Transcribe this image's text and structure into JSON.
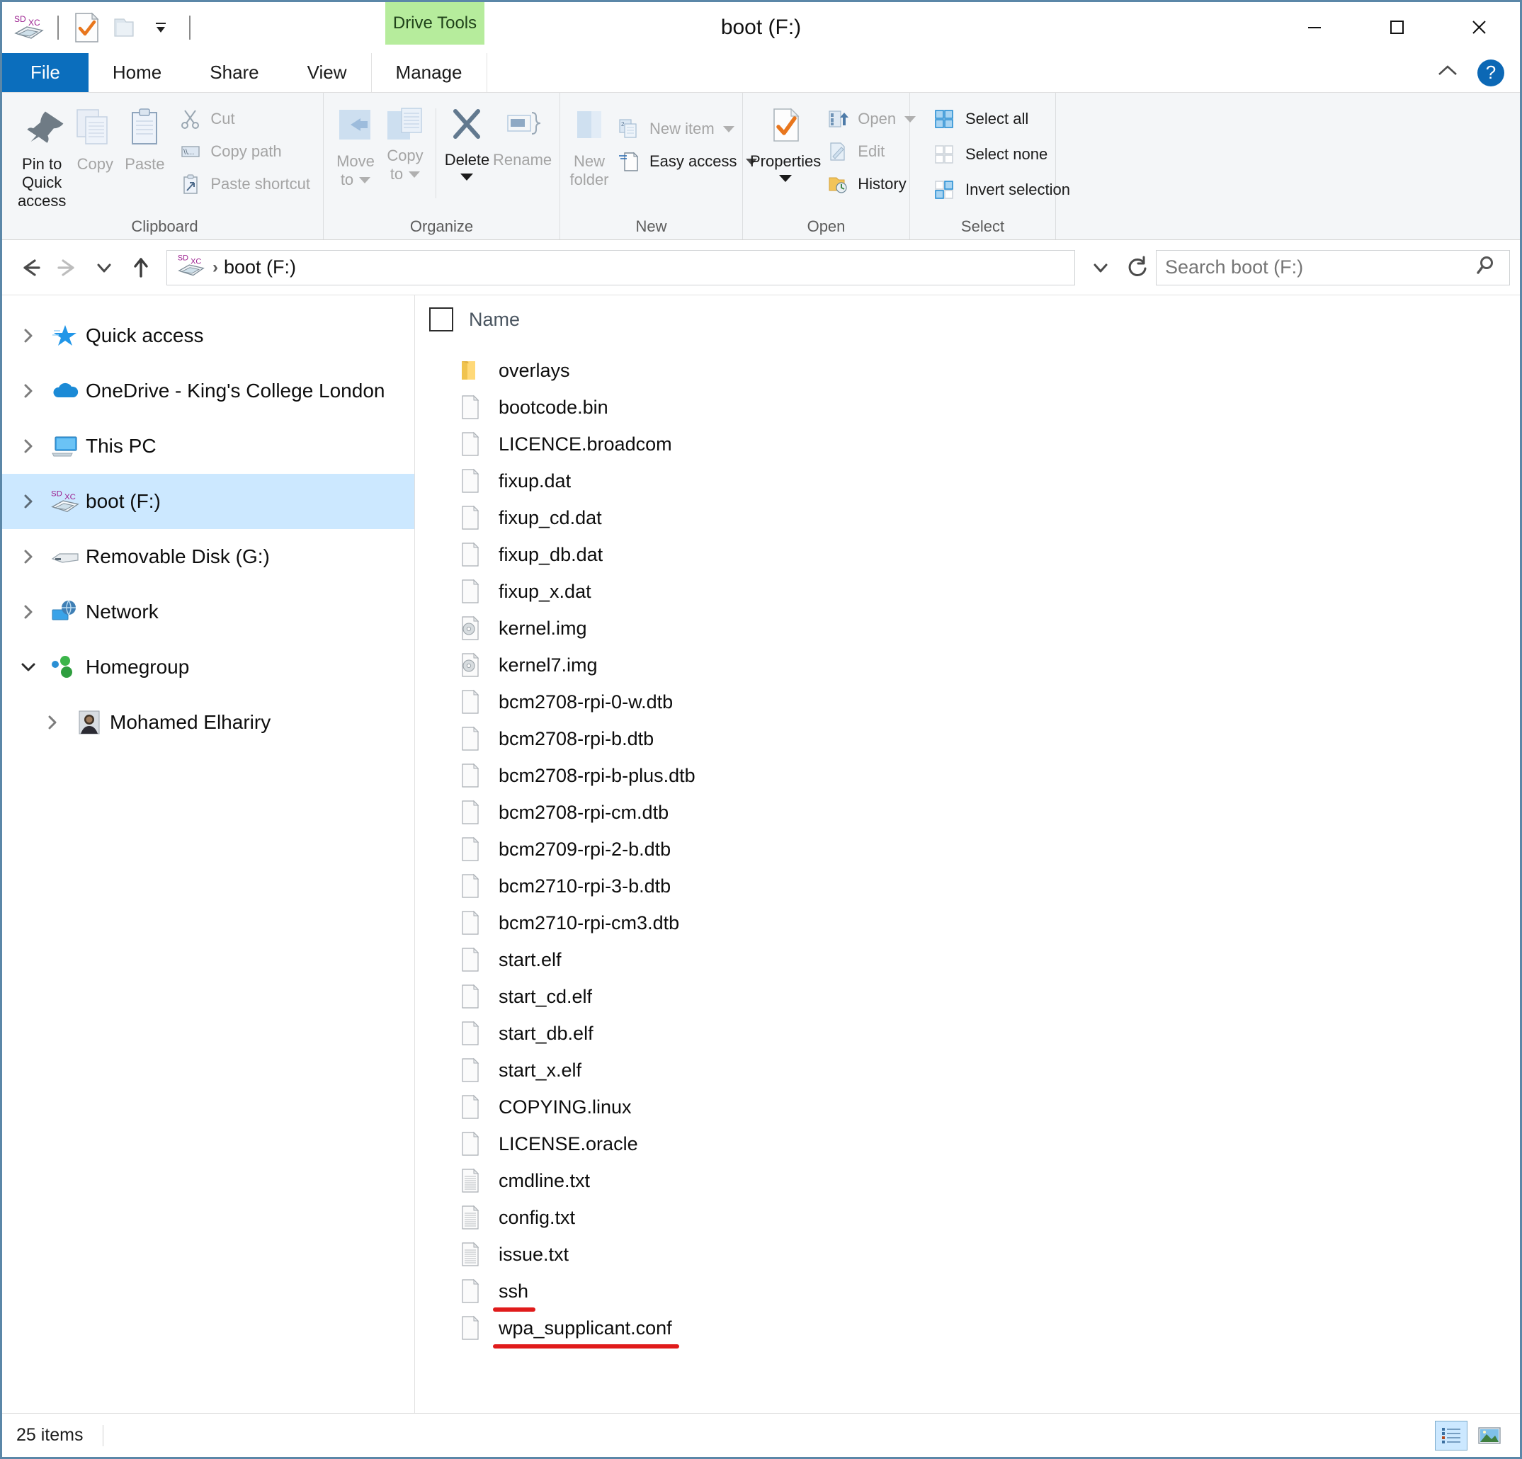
{
  "window": {
    "title": "boot (F:)",
    "contextual_tab": "Drive Tools",
    "minimize_label": "Minimize",
    "maximize_label": "Maximize",
    "close_label": "Close"
  },
  "quick_access_toolbar": {
    "items": [
      {
        "name": "drive-icon",
        "label": "boot (F:)"
      },
      {
        "name": "properties-icon",
        "label": "Properties"
      },
      {
        "name": "new-folder-icon",
        "label": "New folder"
      },
      {
        "name": "customize-icon",
        "label": "Customize Quick Access Toolbar"
      }
    ]
  },
  "tabs": [
    {
      "label": "File",
      "active": false,
      "kind": "file"
    },
    {
      "label": "Home",
      "active": true,
      "kind": "normal"
    },
    {
      "label": "Share",
      "active": false,
      "kind": "normal"
    },
    {
      "label": "View",
      "active": false,
      "kind": "normal"
    },
    {
      "label": "Manage",
      "active": false,
      "kind": "contextual"
    }
  ],
  "tab_right": {
    "collapse_ribbon_label": "Minimize the Ribbon",
    "help_label": "?"
  },
  "ribbon": {
    "groups": [
      {
        "title": "Clipboard",
        "big_buttons": [
          {
            "label": "Pin to Quick access",
            "label_line1": "Pin to Quick",
            "label_line2": "access",
            "icon": "pin-icon",
            "disabled": false
          },
          {
            "label": "Copy",
            "icon": "copy-icon",
            "disabled": true
          },
          {
            "label": "Paste",
            "icon": "paste-icon",
            "disabled": true
          }
        ],
        "small_buttons": [
          {
            "label": "Cut",
            "icon": "scissors-icon",
            "disabled": true,
            "dropdown": false
          },
          {
            "label": "Copy path",
            "icon": "copy-path-icon",
            "disabled": true,
            "dropdown": false
          },
          {
            "label": "Paste shortcut",
            "icon": "paste-shortcut-icon",
            "disabled": true,
            "dropdown": false
          }
        ]
      },
      {
        "title": "Organize",
        "big_buttons": [
          {
            "label": "Move to",
            "label_line1": "Move",
            "label_line2": "to",
            "icon": "move-to-icon",
            "disabled": true,
            "dropdown": true
          },
          {
            "label": "Copy to",
            "label_line1": "Copy",
            "label_line2": "to",
            "icon": "copy-to-icon",
            "disabled": true,
            "dropdown": true
          },
          {
            "label": "Delete",
            "icon": "delete-icon",
            "disabled": false,
            "dropdown": true
          },
          {
            "label": "Rename",
            "icon": "rename-icon",
            "disabled": true,
            "dropdown": false
          }
        ],
        "small_buttons": []
      },
      {
        "title": "New",
        "big_buttons": [
          {
            "label": "New folder",
            "label_line1": "New",
            "label_line2": "folder",
            "icon": "new-folder-icon",
            "disabled": true
          }
        ],
        "small_buttons": [
          {
            "label": "New item",
            "icon": "new-item-icon",
            "disabled": true,
            "dropdown": true
          },
          {
            "label": "Easy access",
            "icon": "easy-access-icon",
            "disabled": false,
            "dropdown": true
          }
        ]
      },
      {
        "title": "Open",
        "big_buttons": [
          {
            "label": "Properties",
            "icon": "properties-icon",
            "disabled": false,
            "dropdown": true
          }
        ],
        "small_buttons": [
          {
            "label": "Open",
            "icon": "open-icon",
            "disabled": true,
            "dropdown": true
          },
          {
            "label": "Edit",
            "icon": "edit-icon",
            "disabled": true,
            "dropdown": false
          },
          {
            "label": "History",
            "icon": "history-icon",
            "disabled": false,
            "dropdown": false
          }
        ]
      },
      {
        "title": "Select",
        "big_buttons": [],
        "small_buttons": [
          {
            "label": "Select all",
            "icon": "select-all-icon",
            "disabled": false,
            "dropdown": false
          },
          {
            "label": "Select none",
            "icon": "select-none-icon",
            "disabled": false,
            "dropdown": false
          },
          {
            "label": "Invert selection",
            "icon": "invert-selection-icon",
            "disabled": false,
            "dropdown": false
          }
        ]
      }
    ]
  },
  "address_bar": {
    "back_label": "Back",
    "forward_label": "Forward",
    "recent_label": "Recent locations",
    "up_label": "Up one level",
    "breadcrumb_icon": "sdxc-drive-icon",
    "breadcrumb": [
      "boot (F:)"
    ],
    "dropdown_label": "Previous locations",
    "refresh_label": "Refresh"
  },
  "search": {
    "placeholder": "Search boot (F:)",
    "value": "",
    "icon": "search-icon"
  },
  "nav_pane": {
    "items": [
      {
        "label": "Quick access",
        "icon": "star-icon",
        "expanded": false,
        "selected": false,
        "child": false
      },
      {
        "label": "OneDrive - King's College London",
        "icon": "onedrive-cloud-icon",
        "expanded": false,
        "selected": false,
        "child": false
      },
      {
        "label": "This PC",
        "icon": "this-pc-icon",
        "expanded": false,
        "selected": false,
        "child": false
      },
      {
        "label": "boot (F:)",
        "icon": "sdxc-drive-icon",
        "expanded": false,
        "selected": true,
        "child": false
      },
      {
        "label": "Removable Disk (G:)",
        "icon": "removable-disk-icon",
        "expanded": false,
        "selected": false,
        "child": false
      },
      {
        "label": "Network",
        "icon": "network-icon",
        "expanded": false,
        "selected": false,
        "child": false
      },
      {
        "label": "Homegroup",
        "icon": "homegroup-icon",
        "expanded": true,
        "selected": false,
        "child": false
      },
      {
        "label": "Mohamed Elhariry",
        "icon": "user-avatar-icon",
        "expanded": false,
        "selected": false,
        "child": true
      }
    ]
  },
  "file_list": {
    "columns": [
      "Name"
    ],
    "select_all_checkbox": false,
    "rows": [
      {
        "name": "overlays",
        "icon": "folder-icon",
        "highlighted": false
      },
      {
        "name": "bootcode.bin",
        "icon": "file-icon",
        "highlighted": false
      },
      {
        "name": "LICENCE.broadcom",
        "icon": "file-icon",
        "highlighted": false
      },
      {
        "name": "fixup.dat",
        "icon": "file-icon",
        "highlighted": false
      },
      {
        "name": "fixup_cd.dat",
        "icon": "file-icon",
        "highlighted": false
      },
      {
        "name": "fixup_db.dat",
        "icon": "file-icon",
        "highlighted": false
      },
      {
        "name": "fixup_x.dat",
        "icon": "file-icon",
        "highlighted": false
      },
      {
        "name": "kernel.img",
        "icon": "disc-image-icon",
        "highlighted": false
      },
      {
        "name": "kernel7.img",
        "icon": "disc-image-icon",
        "highlighted": false
      },
      {
        "name": "bcm2708-rpi-0-w.dtb",
        "icon": "file-icon",
        "highlighted": false
      },
      {
        "name": "bcm2708-rpi-b.dtb",
        "icon": "file-icon",
        "highlighted": false
      },
      {
        "name": "bcm2708-rpi-b-plus.dtb",
        "icon": "file-icon",
        "highlighted": false
      },
      {
        "name": "bcm2708-rpi-cm.dtb",
        "icon": "file-icon",
        "highlighted": false
      },
      {
        "name": "bcm2709-rpi-2-b.dtb",
        "icon": "file-icon",
        "highlighted": false
      },
      {
        "name": "bcm2710-rpi-3-b.dtb",
        "icon": "file-icon",
        "highlighted": false
      },
      {
        "name": "bcm2710-rpi-cm3.dtb",
        "icon": "file-icon",
        "highlighted": false
      },
      {
        "name": "start.elf",
        "icon": "file-icon",
        "highlighted": false
      },
      {
        "name": "start_cd.elf",
        "icon": "file-icon",
        "highlighted": false
      },
      {
        "name": "start_db.elf",
        "icon": "file-icon",
        "highlighted": false
      },
      {
        "name": "start_x.elf",
        "icon": "file-icon",
        "highlighted": false
      },
      {
        "name": "COPYING.linux",
        "icon": "file-icon",
        "highlighted": false
      },
      {
        "name": "LICENSE.oracle",
        "icon": "file-icon",
        "highlighted": false
      },
      {
        "name": "cmdline.txt",
        "icon": "text-file-icon",
        "highlighted": false
      },
      {
        "name": "config.txt",
        "icon": "text-file-icon",
        "highlighted": false
      },
      {
        "name": "issue.txt",
        "icon": "text-file-icon",
        "highlighted": false
      },
      {
        "name": "ssh",
        "icon": "file-icon",
        "highlighted": true
      },
      {
        "name": "wpa_supplicant.conf",
        "icon": "file-icon",
        "highlighted": true
      }
    ]
  },
  "status_bar": {
    "item_count": "25 items",
    "views": [
      {
        "name": "details-view-button",
        "label": "Details view",
        "selected": true
      },
      {
        "name": "large-icons-view-button",
        "label": "Large icons view",
        "selected": false
      }
    ]
  },
  "colors": {
    "accent": "#0b6ebd",
    "window_border": "#5b87a8",
    "contextual_tab_bg": "#b6ec9c",
    "selection_bg": "#cce8ff",
    "annotation_red": "#e01b1b",
    "ribbon_bg": "#f4f6f8"
  }
}
